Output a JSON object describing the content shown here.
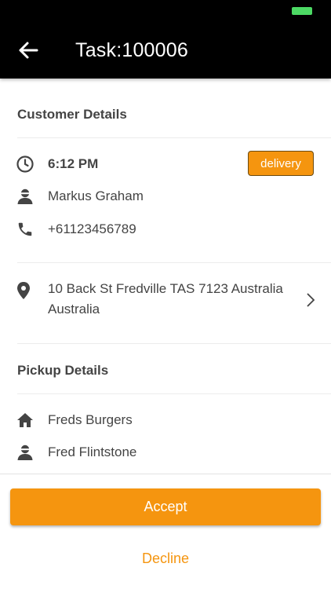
{
  "header": {
    "title": "Task:100006",
    "back_icon": "arrow-left-icon"
  },
  "customer": {
    "section_title": "Customer Details",
    "time": "6:12 PM",
    "type_badge": "delivery",
    "name": "Markus Graham",
    "phone": "+61123456789",
    "address": "10 Back St Fredville TAS 7123 Australia Australia"
  },
  "pickup": {
    "section_title": "Pickup Details",
    "store": "Freds Burgers",
    "contact": "Fred Flintstone"
  },
  "actions": {
    "accept": "Accept",
    "decline": "Decline"
  },
  "colors": {
    "accent": "#f5950f",
    "header_bg": "#000000",
    "text": "#444444",
    "battery": "#4cd964"
  }
}
